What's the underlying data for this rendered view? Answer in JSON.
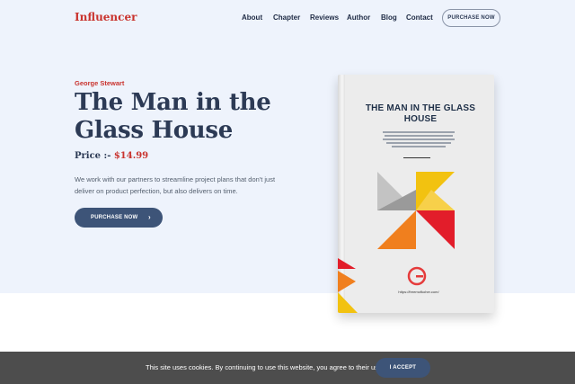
{
  "brand": {
    "logo": "Influencer"
  },
  "nav": {
    "items": [
      {
        "label": "About"
      },
      {
        "label": "Chapter"
      },
      {
        "label": "Reviews"
      },
      {
        "label": "Author"
      },
      {
        "label": "Blog"
      },
      {
        "label": "Contact"
      }
    ],
    "cta_label": "PURCHASE NOW"
  },
  "hero": {
    "author": "George Stewart",
    "title": "The Man in the Glass House",
    "price_label": "Price :- ",
    "price_value": "$14.99",
    "description": "We work with our partners to streamline project plans that don't just deliver on product perfection, but also delivers on time.",
    "cta_label": "PURCHASE NOW",
    "cta_icon": "chevron-right-icon"
  },
  "book": {
    "cover_title": "THE MAN IN THE GLASS HOUSE",
    "url": "https://freemofkoher.com/"
  },
  "cookie": {
    "text": "This site uses cookies. By continuing to use this website, you agree to their use.",
    "accept_label": "I ACCEPT"
  },
  "colors": {
    "accent": "#c9332e",
    "navy": "#2c3a55",
    "button": "#3d5478",
    "hero_bg": "#eef3fc",
    "cookie_bg": "#4d4d4d"
  }
}
